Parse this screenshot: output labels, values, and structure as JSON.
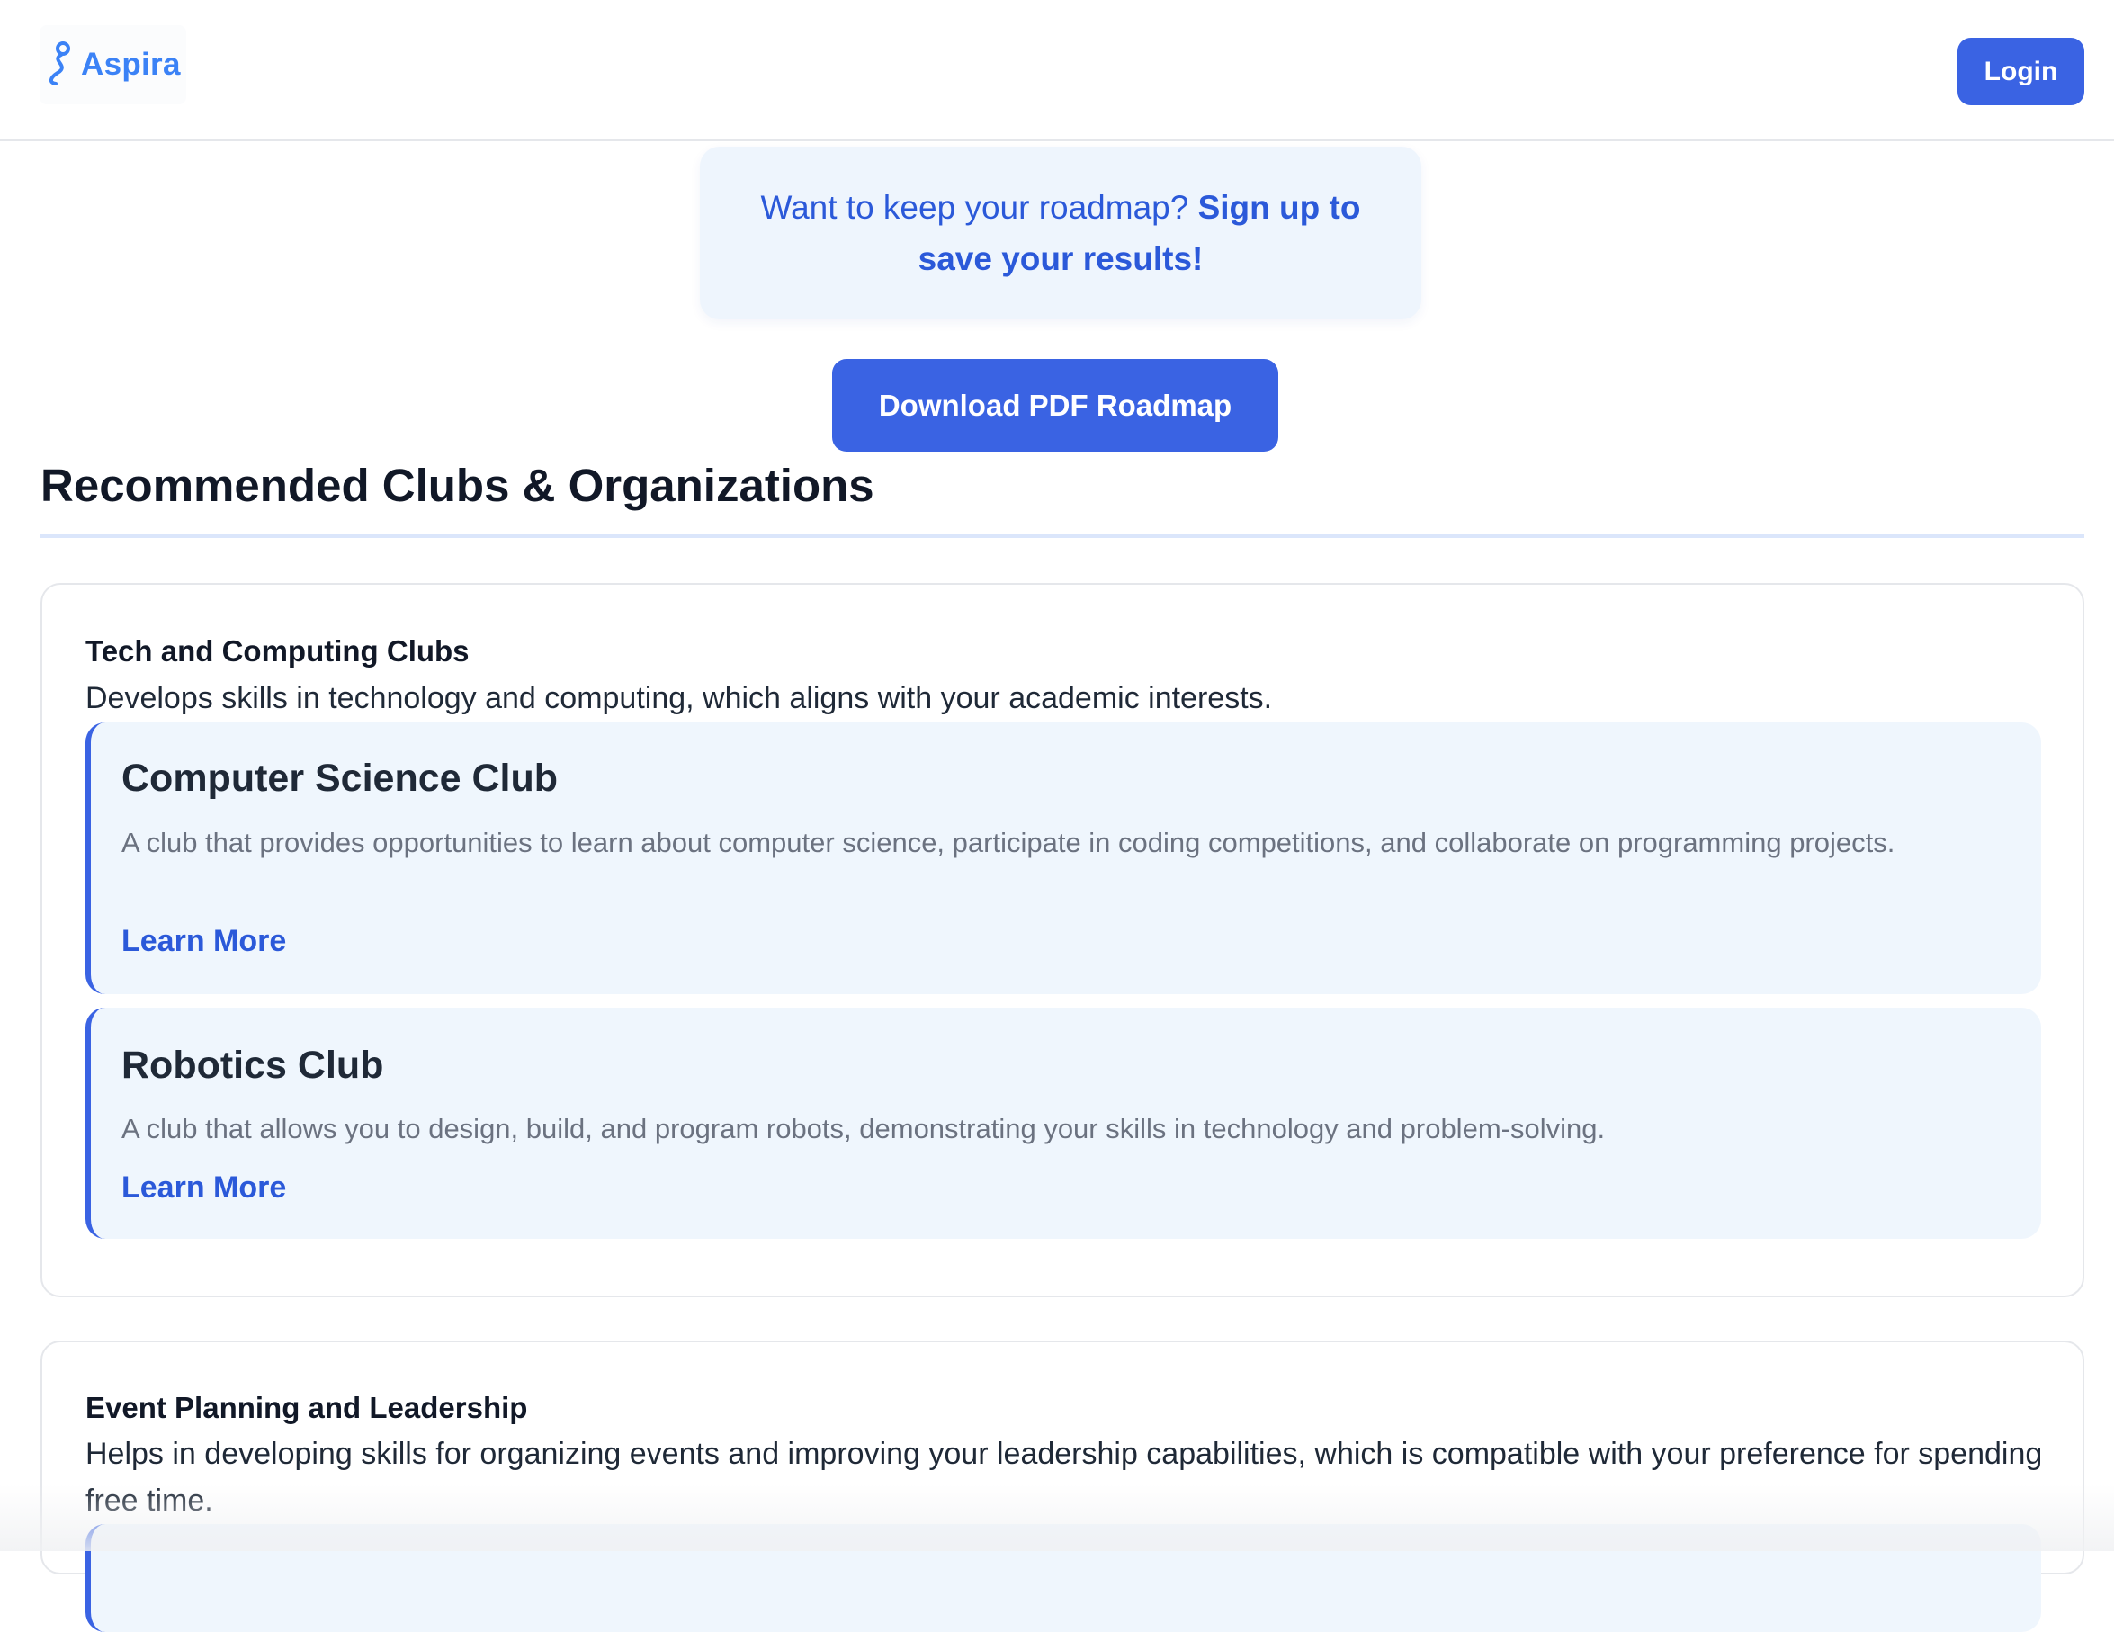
{
  "header": {
    "logo_text": "Aspira",
    "login_label": "Login"
  },
  "banner": {
    "text_prefix": "Want to keep your roadmap? ",
    "link_text": "Sign up to save your results!"
  },
  "download_label": "Download PDF Roadmap",
  "section": {
    "title": "Recommended Clubs & Organizations"
  },
  "categories": [
    {
      "title": "Tech and Computing Clubs",
      "description": "Develops skills in technology and computing, which aligns with your academic interests.",
      "clubs": [
        {
          "name": "Computer Science Club",
          "description": "A club that provides opportunities to learn about computer science, participate in coding competitions, and collaborate on programming projects.",
          "link_label": "Learn More"
        },
        {
          "name": "Robotics Club",
          "description": "A club that allows you to design, build, and program robots, demonstrating your skills in technology and problem-solving.",
          "link_label": "Learn More"
        }
      ]
    },
    {
      "title": "Event Planning and Leadership",
      "description": "Helps in developing skills for organizing events and improving your leadership capabilities, which is compatible with your preference for spending free time."
    }
  ],
  "colors": {
    "accent": "#3a63e3",
    "link": "#2b59d9",
    "logo": "#3b82f6",
    "club_card_bg": "#eff6fd"
  }
}
